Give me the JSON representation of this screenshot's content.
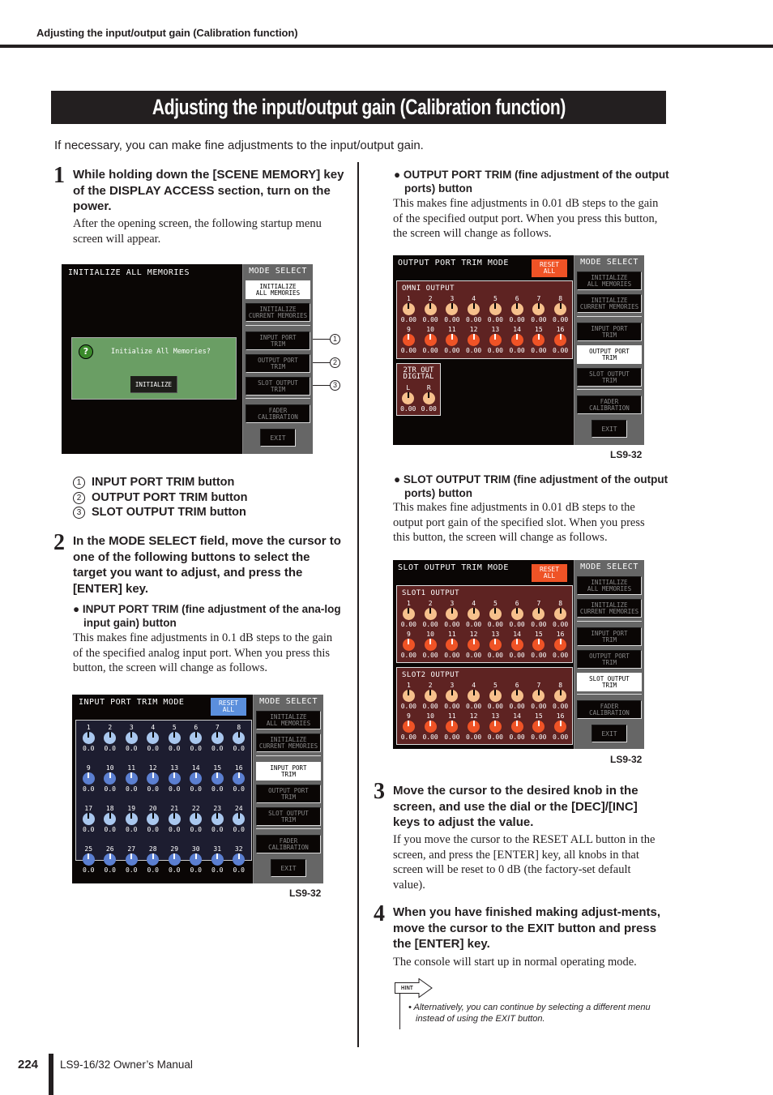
{
  "running_head": "Adjusting the input/output gain (Calibration function)",
  "section_title": "Adjusting the input/output gain (Calibration function)",
  "intro": "If necessary, you can make fine adjustments to the input/output gain.",
  "steps": [
    {
      "number": "1",
      "heading": "While holding down the [SCENE MEMORY] key of the DISPLAY ACCESS section, turn on the power.",
      "body": "After the opening screen, the following startup menu screen will appear."
    },
    {
      "number": "2",
      "heading": "In the MODE SELECT field, move the cursor to one of the following buttons to select the target you want to adjust, and press the [ENTER] key."
    },
    {
      "number": "3",
      "heading": "Move the cursor to the desired knob in the screen, and use the dial or the [DEC]/[INC] keys to adjust the value.",
      "body": "If you move the cursor to the RESET ALL button in the screen, and press the [ENTER] key, all knobs in that screen will be reset to 0 dB (the factory-set default value)."
    },
    {
      "number": "4",
      "heading": "When you have finished making adjust-ments, move the cursor to the EXIT button and press the [ENTER] key.",
      "body": "The console will start up in normal operating mode."
    }
  ],
  "legend": [
    {
      "num": "1",
      "label": "INPUT PORT TRIM button"
    },
    {
      "num": "2",
      "label": "OUTPUT PORT TRIM button"
    },
    {
      "num": "3",
      "label": "SLOT OUTPUT TRIM button"
    }
  ],
  "bullets": {
    "input": {
      "heading": "INPUT PORT TRIM (fine adjustment of the ana-log input gain) button",
      "body": "This makes fine adjustments in 0.1 dB steps to the gain of the specified analog input port. When you press this button, the screen will change as follows."
    },
    "output": {
      "heading": "OUTPUT PORT TRIM (fine adjustment of the output ports) button",
      "body": "This makes fine adjustments in 0.01 dB steps to the gain of the specified output port. When you press this button, the screen will change as follows."
    },
    "slot": {
      "heading": "SLOT OUTPUT TRIM (fine adjustment of the output ports) button",
      "body": "This makes fine adjustments in 0.01 dB steps to the output port gain of the specified slot. When you press this button, the screen will change as follows."
    }
  },
  "mode_select": {
    "title": "MODE SELECT",
    "buttons": [
      "INITIALIZE\nALL MEMORIES",
      "INITIALIZE\nCURRENT MEMORIES",
      "INPUT PORT\nTRIM",
      "OUTPUT PORT\nTRIM",
      "SLOT OUTPUT\nTRIM",
      "FADER\nCALIBRATION"
    ],
    "exit": "EXIT"
  },
  "screens": {
    "init": {
      "title": "INITIALIZE ALL MEMORIES",
      "dialog_text": "Initialize All Memories?",
      "dialog_button": "INITIALIZE",
      "active_mode": 0
    },
    "input": {
      "title": "INPUT PORT TRIM MODE",
      "reset": "RESET\nALL",
      "active_mode": 2,
      "caption": "LS9-32",
      "knob_value": "0.0",
      "channels": 32
    },
    "output": {
      "title": "OUTPUT PORT TRIM MODE",
      "reset": "RESET\nALL",
      "active_mode": 3,
      "caption": "LS9-32",
      "group1_label": "OMNI OUTPUT",
      "group2_label": "2TR OUT\nDIGITAL",
      "group2_channels": [
        "L",
        "R"
      ],
      "knob_value": "0.00",
      "channels": 16
    },
    "slot": {
      "title": "SLOT OUTPUT TRIM MODE",
      "reset": "RESET\nALL",
      "active_mode": 4,
      "caption": "LS9-32",
      "group1_label": "SLOT1 OUTPUT",
      "group2_label": "SLOT2 OUTPUT",
      "knob_value": "0.00",
      "channels": 16
    }
  },
  "colors": {
    "blue_light": "#a9c7ee",
    "blue_dark": "#5b7fd1",
    "peach": "#f6c08c",
    "orange": "#ef5326",
    "group_bg": "#5e2322",
    "reset_blue": "#5b8fdc",
    "reset_orange": "#ef5326",
    "dialog_green": "#6a9e64"
  },
  "hint": {
    "label": "HINT",
    "text": "Alternatively, you can continue by selecting a different menu instead of using the EXIT button."
  },
  "footer": {
    "page_number": "224",
    "manual_title": "LS9-16/32  Owner’s Manual"
  }
}
